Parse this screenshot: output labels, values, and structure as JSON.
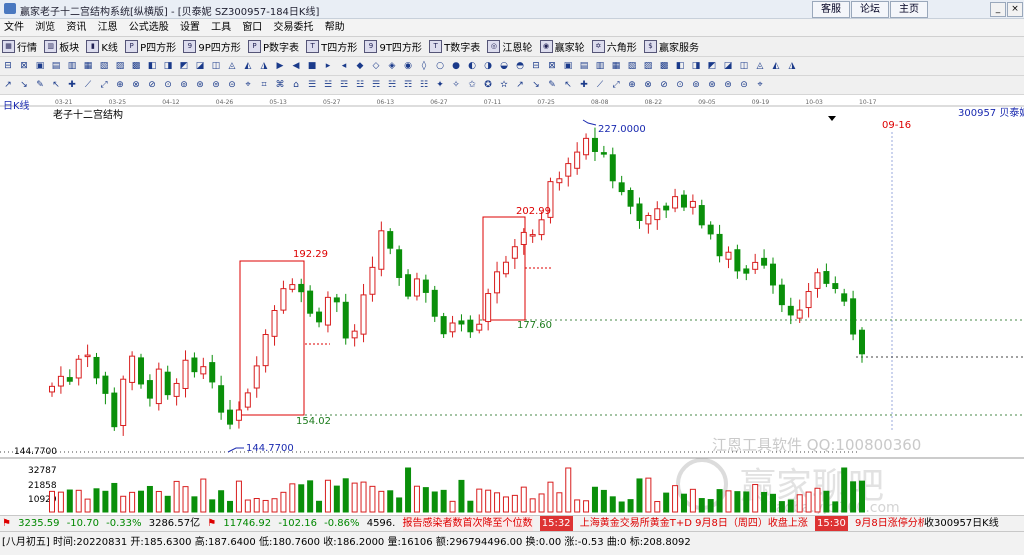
{
  "window": {
    "title": "赢家老子十二宫结构系统[纵横版] - [贝泰妮  SZ300957-184日K线]",
    "top_buttons": [
      "客服",
      "论坛",
      "主页"
    ]
  },
  "menu": [
    "文件",
    "浏览",
    "资讯",
    "江恩",
    "公式选股",
    "设置",
    "工具",
    "窗口",
    "交易委托",
    "帮助"
  ],
  "toolbar1": [
    {
      "label": "行情",
      "icon": "grid-icon"
    },
    {
      "label": "板块",
      "icon": "blocks-icon"
    },
    {
      "label": "K线",
      "icon": "candle-icon"
    },
    {
      "label": "P四方形",
      "icon": "square-icon"
    },
    {
      "label": "9P四方形",
      "icon": "square9-icon"
    },
    {
      "label": "P数字表",
      "icon": "table-icon"
    },
    {
      "label": "T四方形",
      "icon": "tsquare-icon"
    },
    {
      "label": "9T四方形",
      "icon": "tsquare9-icon"
    },
    {
      "label": "T数字表",
      "icon": "ttable-icon"
    },
    {
      "label": "江恩轮",
      "icon": "wheel-icon"
    },
    {
      "label": "赢家轮",
      "icon": "wheel2-icon"
    },
    {
      "label": "六角形",
      "icon": "hexagon-icon"
    },
    {
      "label": "赢家服务",
      "icon": "service-icon"
    }
  ],
  "date_ticks": [
    "03-21",
    "03-25",
    "04-12",
    "04-26",
    "05-13",
    "05-27",
    "06-13",
    "06-27",
    "07-11",
    "07-25",
    "08-08",
    "08-22",
    "09-05",
    "09-19",
    "10-03",
    "10-17"
  ],
  "chart": {
    "period_label": "日K线",
    "indicator_label": "老子十二宫结构",
    "stock_label": "300957  贝泰妮",
    "future_date_label": "09-16",
    "annotations": {
      "high_227": "227.0000",
      "low_144": "144.7700",
      "box1_top": "192.29",
      "box1_bottom": "154.02",
      "box2_top": "202.99",
      "box2_bottom": "177.60"
    },
    "axis_price_label": "144.7700",
    "volume_ticks": [
      "32787",
      "21858",
      "10929"
    ],
    "watermark1": "江恩工具软件   QQ:100800360",
    "watermark2": "赢家聊吧",
    "watermark3": "liaoba.yjcl360.com"
  },
  "status1": {
    "sh_value": "3235.59",
    "sh_change": "-10.70",
    "sh_pct": "-0.33%",
    "sh_amount": "3286.57亿",
    "sz_value": "11746.92",
    "sz_change": "-102.16",
    "sz_pct": "-0.86%",
    "sz_amount": "4596.",
    "news1": "报告感染者数首次降至个位数",
    "news1_time": "15:32",
    "news2": "上海黄金交易所黄金T+D 9月8日（周四）收盘上涨",
    "news2_time": "15:30",
    "news3": "9月8日涨停分析",
    "right_label": "收300957日K线"
  },
  "status2": {
    "text": "[八月初五] 时间:20220831 开:185.6300 高:187.6400 低:180.7600 收:186.2000 量:16106 额:296794496.00 换:0.00 涨:-0.53 曲:0 标:208.8092"
  },
  "chart_data": {
    "type": "candlestick",
    "y_range": [
      144.77,
      227.0
    ],
    "highlights": {
      "high": 227.0,
      "low": 144.77
    }
  },
  "colors": {
    "up": "#d81e1e",
    "down": "#0a8f0a",
    "annotation_red": "#d00000",
    "annotation_green": "#1a7a1a",
    "annotation_blue": "#1a2ab0"
  }
}
